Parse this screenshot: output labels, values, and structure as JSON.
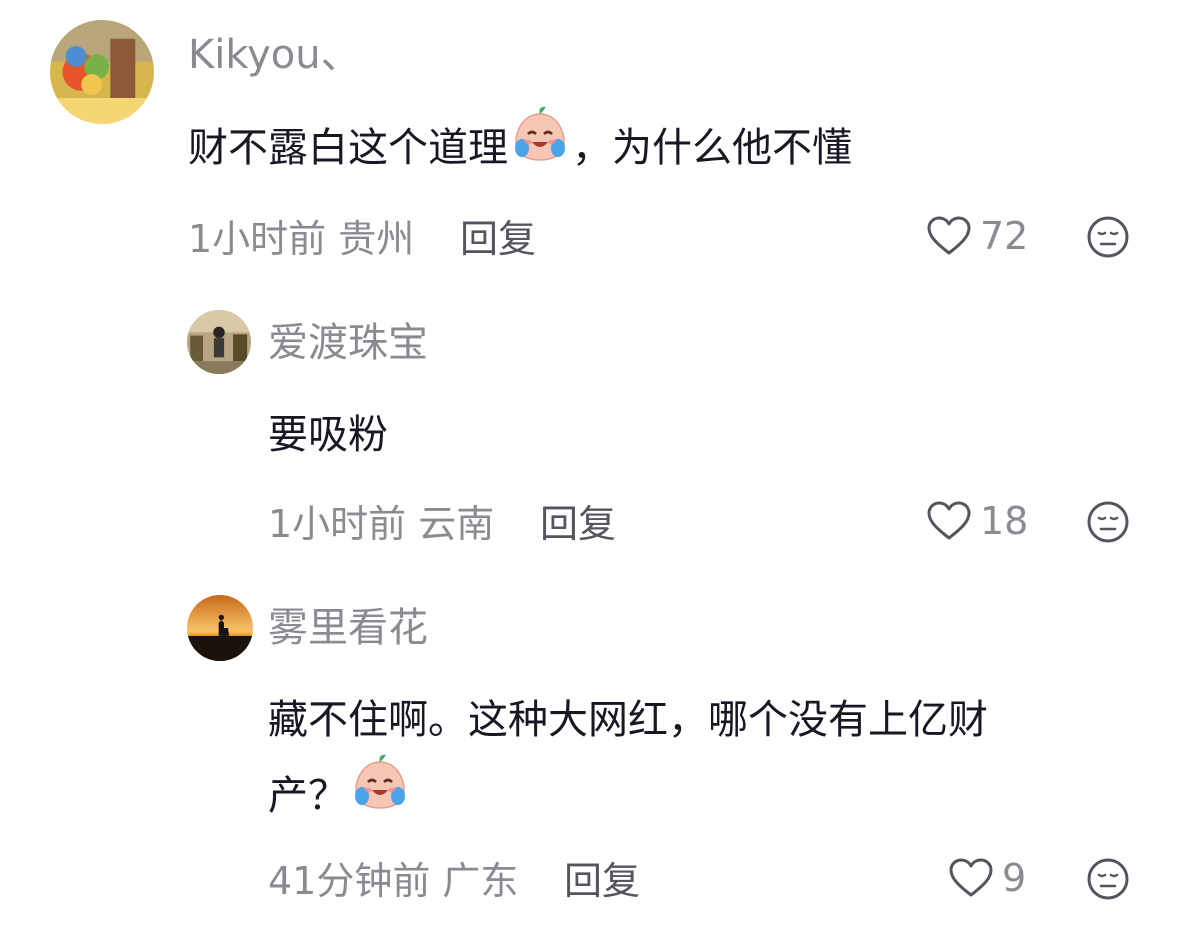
{
  "comments": [
    {
      "username": "Kikyou、",
      "lines": [
        {
          "before": "财不露白这个道理",
          "emoji": "crying-laughing-peach-emoji",
          "after": "，为什么他不懂"
        }
      ],
      "time": "1小时前",
      "location": "贵州",
      "reply_label": "回复",
      "likes": "72",
      "avatar_colors": [
        "#c9a347",
        "#e8542c",
        "#7ab04a",
        "#f4d774"
      ]
    },
    {
      "username": "爱渡珠宝",
      "lines": [
        {
          "before": "要吸粉",
          "emoji": "",
          "after": ""
        }
      ],
      "time": "1小时前",
      "location": "云南",
      "reply_label": "回复",
      "likes": "18",
      "avatar_colors": [
        "#8a7a5c",
        "#3b3a36",
        "#d8c8a8",
        "#5a6a4a"
      ]
    },
    {
      "username": "雾里看花",
      "lines": [
        {
          "before": "藏不住啊。这种大网红，哪个没有上亿财",
          "emoji": "",
          "after": ""
        },
        {
          "before": "产？",
          "emoji": "crying-laughing-peach-emoji",
          "after": ""
        }
      ],
      "time": "41分钟前",
      "location": "广东",
      "reply_label": "回复",
      "likes": "9",
      "avatar_colors": [
        "#f2a12a",
        "#2a1c12",
        "#f7c46a",
        "#c86a1a"
      ]
    }
  ],
  "icons": {
    "like": "heart-outline-icon",
    "dislike": "meh-face-icon"
  },
  "colors": {
    "text_primary": "#161823",
    "text_secondary": "#8a8b91",
    "reply": "#55565d"
  }
}
